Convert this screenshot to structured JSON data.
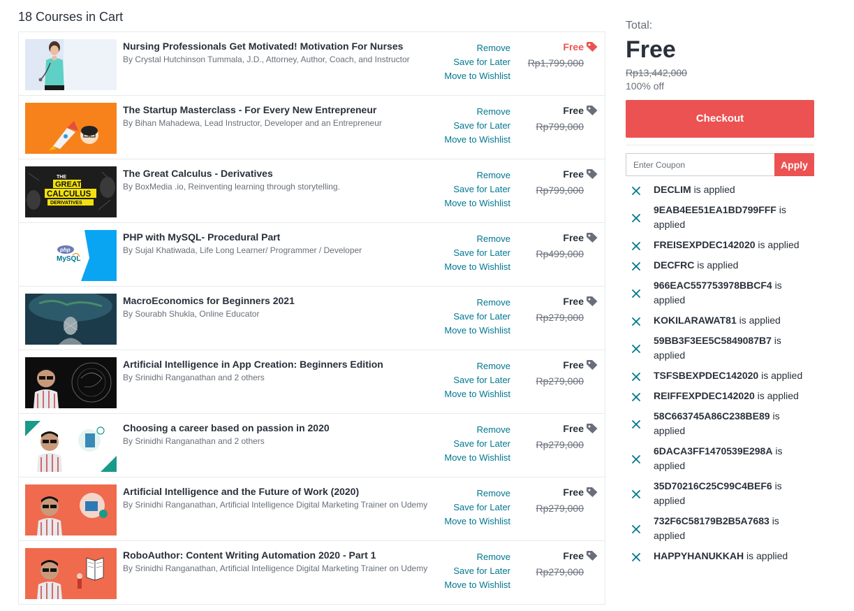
{
  "cart": {
    "heading": "18 Courses in Cart"
  },
  "courses": [
    {
      "title": "Nursing Professionals Get Motivated! Motivation For Nurses",
      "author": "By Crystal Hutchinson Tummala, J.D., Attorney, Author, Coach, and Instructor",
      "remove": "Remove",
      "save_later": "Save for Later",
      "wishlist": "Move to Wishlist",
      "price": "Free",
      "old_price": "Rp1,799,000"
    },
    {
      "title": "The Startup Masterclass - For Every New Entrepreneur",
      "author": "By Bihan Mahadewa, Lead Instructor, Developer and an Entrepreneur",
      "remove": "Remove",
      "save_later": "Save for Later",
      "wishlist": "Move to Wishlist",
      "price": "Free",
      "old_price": "Rp799,000"
    },
    {
      "title": "The Great Calculus - Derivatives",
      "author": "By BoxMedia .io, Reinventing learning through storytelling.",
      "remove": "Remove",
      "save_later": "Save for Later",
      "wishlist": "Move to Wishlist",
      "price": "Free",
      "old_price": "Rp799,000"
    },
    {
      "title": "PHP with MySQL- Procedural Part",
      "author": "By Sujal Khatiwada, Life Long Learner/ Programmer / Developer",
      "remove": "Remove",
      "save_later": "Save for Later",
      "wishlist": "Move to Wishlist",
      "price": "Free",
      "old_price": "Rp499,000"
    },
    {
      "title": "MacroEconomics for Beginners 2021",
      "author": "By Sourabh Shukla, Online Educator",
      "remove": "Remove",
      "save_later": "Save for Later",
      "wishlist": "Move to Wishlist",
      "price": "Free",
      "old_price": "Rp279,000"
    },
    {
      "title": "Artificial Intelligence in App Creation: Beginners Edition",
      "author": "By Srinidhi Ranganathan and 2 others",
      "remove": "Remove",
      "save_later": "Save for Later",
      "wishlist": "Move to Wishlist",
      "price": "Free",
      "old_price": "Rp279,000"
    },
    {
      "title": "Choosing a career based on passion in 2020",
      "author": "By Srinidhi Ranganathan and 2 others",
      "remove": "Remove",
      "save_later": "Save for Later",
      "wishlist": "Move to Wishlist",
      "price": "Free",
      "old_price": "Rp279,000"
    },
    {
      "title": "Artificial Intelligence and the Future of Work (2020)",
      "author": "By Srinidhi Ranganathan, Artificial Intelligence Digital Marketing Trainer on Udemy",
      "remove": "Remove",
      "save_later": "Save for Later",
      "wishlist": "Move to Wishlist",
      "price": "Free",
      "old_price": "Rp279,000"
    },
    {
      "title": "RoboAuthor: Content Writing Automation 2020 - Part 1",
      "author": "By Srinidhi Ranganathan, Artificial Intelligence Digital Marketing Trainer on Udemy",
      "remove": "Remove",
      "save_later": "Save for Later",
      "wishlist": "Move to Wishlist",
      "price": "Free",
      "old_price": "Rp279,000"
    }
  ],
  "thumbs": {
    "calculus": [
      "THE",
      "GREAT",
      "CALCULUS",
      "DERIVATIVES"
    ],
    "php": [
      "php",
      "MySQL"
    ]
  },
  "summary": {
    "total_label": "Total:",
    "total_price": "Free",
    "original_price": "Rp13,442,000",
    "discount": "100% off",
    "checkout_label": "Checkout",
    "coupon_placeholder": "Enter Coupon",
    "apply_label": "Apply",
    "applied_suffix": "is applied"
  },
  "coupons": [
    "DECLIM",
    "9EAB4EE51EA1BD799FFF",
    "FREISEXPDEC142020",
    "DECFRC",
    "966EAC557753978BBCF4",
    "KOKILARAWAT81",
    "59BB3F3EE5C5849087B7",
    "TSFSBEXPDEC142020",
    "REIFFEXPDEC142020",
    "58C663745A86C238BE89",
    "6DACA3FF1470539E298A",
    "35D70216C25C99C4BEF6",
    "732F6C58179B2B5A7683",
    "HAPPYHANUKKAH"
  ],
  "colors": {
    "accent": "#ec5252",
    "link": "#007791",
    "text": "#29303b",
    "muted": "#686f7a"
  },
  "icons": {
    "price_tag": "tag-icon",
    "remove_coupon": "close-icon"
  }
}
